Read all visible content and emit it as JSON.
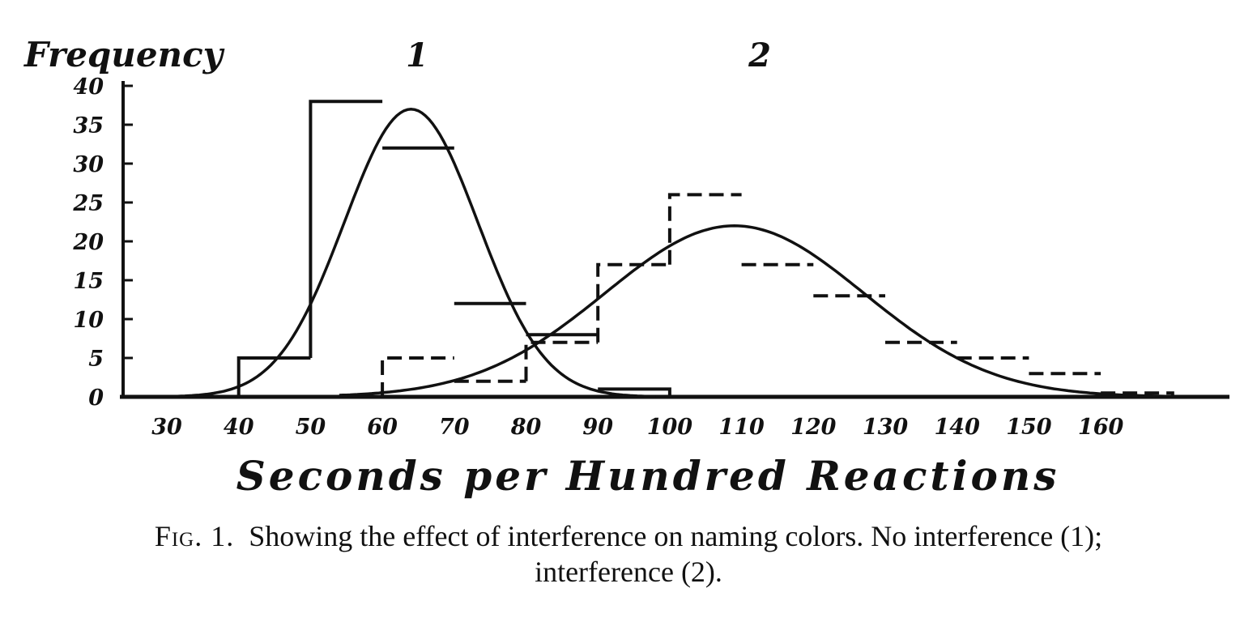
{
  "chart_data": {
    "type": "bar",
    "subtype": "histogram with fitted normal curves",
    "ylabel": "Frequency",
    "xlabel": "Seconds per Hundred Reactions",
    "y_ticks": [
      "0",
      "5",
      "10",
      "15",
      "20",
      "25",
      "30",
      "35",
      "40"
    ],
    "x_ticks": [
      "30",
      "40",
      "50",
      "60",
      "70",
      "80",
      "90",
      "100",
      "110",
      "120",
      "130",
      "140",
      "150",
      "160"
    ],
    "xlim": [
      24,
      177
    ],
    "ylim": [
      0,
      43
    ],
    "grid": false,
    "series": [
      {
        "name": "1",
        "line": "solid",
        "bins": [
          {
            "x0": 40,
            "x1": 50,
            "y": 5
          },
          {
            "x0": 50,
            "x1": 60,
            "y": 38
          },
          {
            "x0": 60,
            "x1": 70,
            "y": 32
          },
          {
            "x0": 70,
            "x1": 80,
            "y": 12
          },
          {
            "x0": 80,
            "x1": 90,
            "y": 8
          },
          {
            "x0": 90,
            "x1": 100,
            "y": 1
          }
        ],
        "curve": {
          "mean": 64,
          "sd": 9.3,
          "peak": 37,
          "x_range": [
            30,
            98
          ]
        }
      },
      {
        "name": "2",
        "line": "dashed",
        "bins": [
          {
            "x0": 60,
            "x1": 70,
            "y": 5
          },
          {
            "x0": 70,
            "x1": 80,
            "y": 2
          },
          {
            "x0": 80,
            "x1": 90,
            "y": 7
          },
          {
            "x0": 90,
            "x1": 100,
            "y": 17
          },
          {
            "x0": 100,
            "x1": 110,
            "y": 26
          },
          {
            "x0": 110,
            "x1": 120,
            "y": 17
          },
          {
            "x0": 120,
            "x1": 130,
            "y": 13
          },
          {
            "x0": 130,
            "x1": 140,
            "y": 7
          },
          {
            "x0": 140,
            "x1": 150,
            "y": 5
          },
          {
            "x0": 150,
            "x1": 160,
            "y": 3
          },
          {
            "x0": 160,
            "x1": 170,
            "y": 0.5
          }
        ],
        "curve": {
          "mean": 109,
          "sd": 18,
          "peak": 22,
          "x_range": [
            54,
            172
          ]
        }
      }
    ]
  },
  "caption": {
    "figure_label": "Fig. 1.",
    "text": "Showing the effect of interference on naming colors.  No interference (1);",
    "text_line2": "interference (2)."
  },
  "colors": {
    "ink": "#111111",
    "paper": "#ffffff"
  }
}
